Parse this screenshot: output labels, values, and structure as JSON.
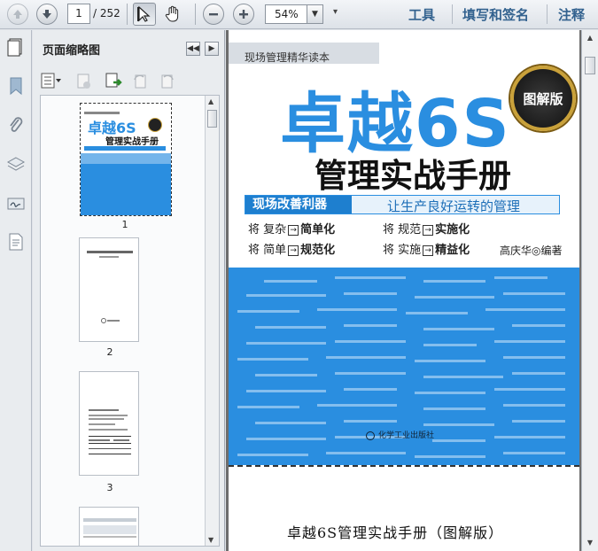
{
  "toolbar": {
    "current_page": "1",
    "total_pages": "/ 252",
    "zoom": "54%",
    "links": [
      "工具",
      "填写和签名",
      "注释"
    ]
  },
  "thumbnails": {
    "title": "页面缩略图",
    "pages": [
      {
        "label": "1",
        "selected": true
      },
      {
        "label": "2",
        "selected": false
      },
      {
        "label": "3",
        "selected": false
      }
    ]
  },
  "cover": {
    "series": "现场管理精华读本",
    "title": "卓越6S",
    "subtitle": "管理实战手册",
    "badge": "图解版",
    "banner_left": "现场改善利器",
    "banner_right": "让生产良好运转的管理",
    "rows": [
      [
        "将 复杂",
        "简单化",
        "将 规范",
        "实施化"
      ],
      [
        "将 简单",
        "规范化",
        "将 实施",
        "精益化"
      ]
    ],
    "author": "高庆华◎编著",
    "publisher": "化学工业出版社",
    "footer": "卓越6S管理实战手册（图解版）"
  },
  "colors": {
    "accent_blue": "#2a8ee0",
    "toolbar_link": "#33628f"
  }
}
